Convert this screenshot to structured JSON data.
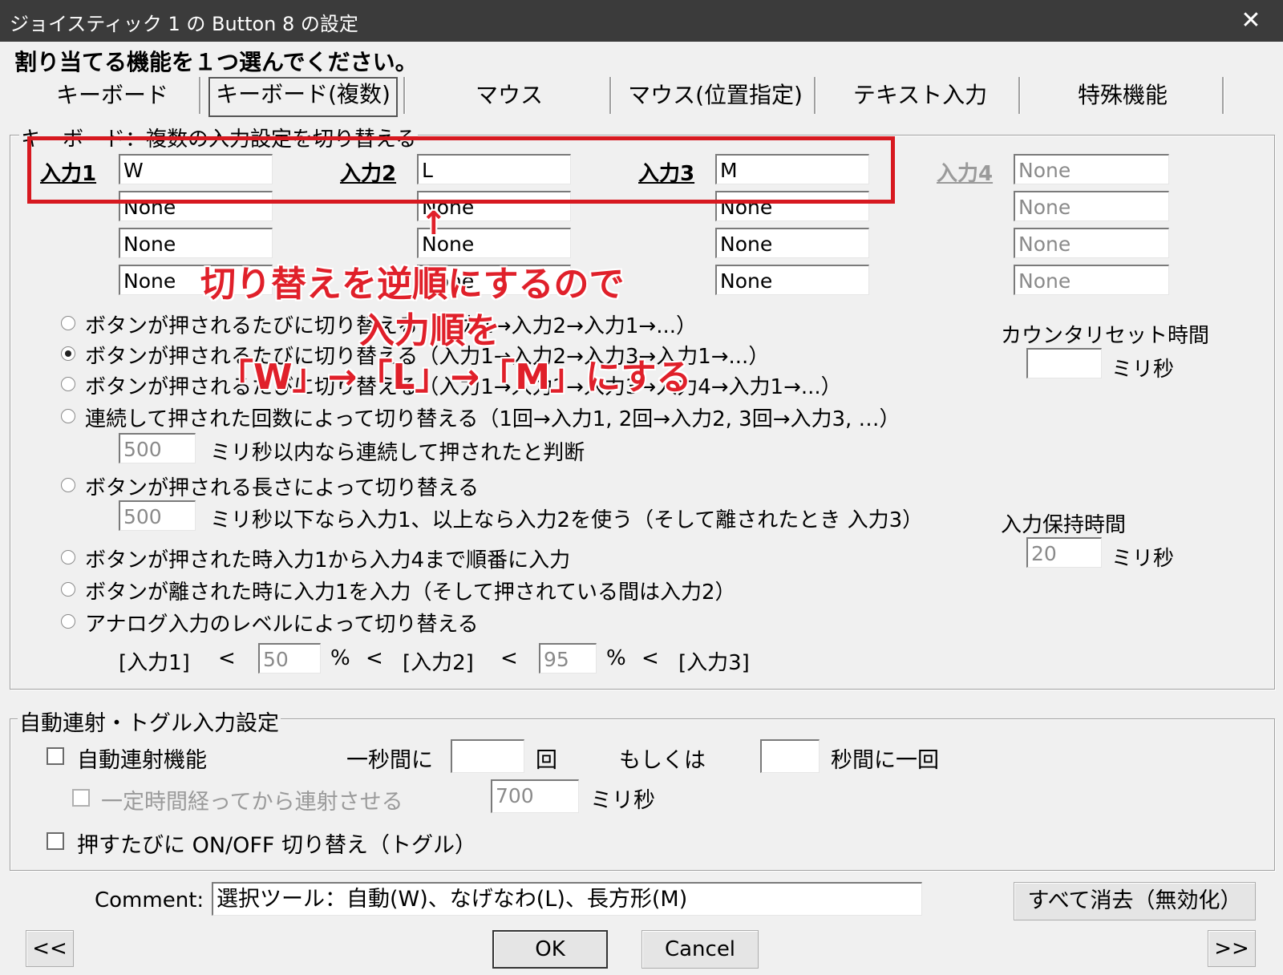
{
  "window": {
    "title": "ジョイスティック 1 の Button 8 の設定"
  },
  "header": {
    "instruction": "割り当てる機能を１つ選んでください。"
  },
  "tabs": [
    "キーボード",
    "キーボード(複数)",
    "マウス",
    "マウス(位置指定)",
    "テキスト入力",
    "特殊機能"
  ],
  "selected_tab": "キーボード(複数)",
  "keyboard_group": {
    "legend": "キーボード：複数の入力設定を切り替える",
    "inputs": [
      {
        "label": "入力1",
        "values": [
          "W",
          "None",
          "None",
          "None"
        ]
      },
      {
        "label": "入力2",
        "values": [
          "L",
          "None",
          "None",
          "None"
        ]
      },
      {
        "label": "入力3",
        "values": [
          "M",
          "None",
          "None",
          "None"
        ]
      },
      {
        "label": "入力4",
        "values": [
          "None",
          "None",
          "None",
          "None"
        ],
        "disabled": true
      }
    ],
    "options": [
      "ボタンが押されるたびに切り替える（入力1→入力2→入力1→...）",
      "ボタンが押されるたびに切り替える（入力1→入力2→入力3→入力1→...）",
      "ボタンが押されるたびに切り替える（入力1→入力2→入力3→入力4→入力1→...）",
      "連続して押された回数によって切り替える（1回→入力1, 2回→入力2, 3回→入力3, …）",
      "ボタンが押される長さによって切り替える",
      "ボタンが押された時入力1から入力4まで順番に入力",
      "ボタンが離された時に入力1を入力（そして押されている間は入力2）",
      "アナログ入力のレベルによって切り替える"
    ],
    "selected_option_index": 1,
    "counter_reset": {
      "label": "カウンタリセット時間",
      "value": "",
      "unit": "ミリ秒"
    },
    "consecutive": {
      "value": "500",
      "text": "ミリ秒以内なら連続して押されたと判断"
    },
    "press_length": {
      "value": "500",
      "text": "ミリ秒以下なら入力1、以上なら入力2を使う（そして離されたとき 入力3）"
    },
    "hold_time": {
      "label": "入力保持時間",
      "value": "20",
      "unit": "ミリ秒"
    },
    "analog": {
      "in1": "[入力1]",
      "lt": "<",
      "val1": "50",
      "pct": "%",
      "in2": "[入力2]",
      "val2": "95",
      "in3": "[入力3]"
    }
  },
  "auto_group": {
    "legend": "自動連射・トグル入力設定",
    "auto_fire": {
      "label": "自動連射機能",
      "per_sec_label": "一秒間に",
      "per_sec_value": "",
      "times_label": "回",
      "or_label": "もしくは",
      "sec_value": "",
      "sec_label": "秒間に一回"
    },
    "delay": {
      "label": "一定時間経ってから連射させる",
      "value": "700",
      "unit": "ミリ秒"
    },
    "toggle": {
      "label": "押すたびに ON/OFF 切り替え（トグル）"
    }
  },
  "footer": {
    "comment_label": "Comment:",
    "comment_value": "選択ツール：自動(W)、なげなわ(L)、長方形(M)",
    "clear_button": "すべて消去（無効化）",
    "prev_button": "<<",
    "next_button": ">>",
    "ok_button": "OK",
    "cancel_button": "Cancel"
  },
  "annotation": {
    "arrow": "↑",
    "line1": "切り替えを逆順にするので",
    "line2": "入力順を",
    "line3": "「W」→「L」→「M」にする",
    "color": "#e0202a"
  }
}
